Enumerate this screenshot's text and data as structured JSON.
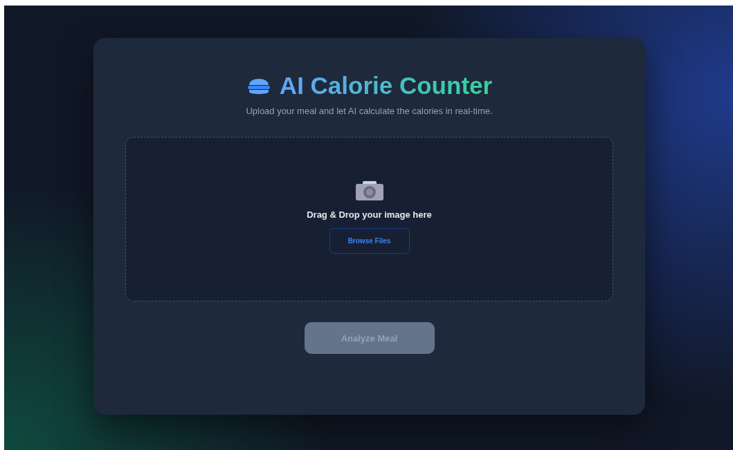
{
  "header": {
    "title": "AI Calorie Counter",
    "subtitle": "Upload your meal and let AI calculate the calories in real-time."
  },
  "dropzone": {
    "prompt": "Drag & Drop your image here",
    "browse_button": "Browse Files"
  },
  "analyze_button": {
    "label": "Analyze Meal",
    "disabled": true
  }
}
